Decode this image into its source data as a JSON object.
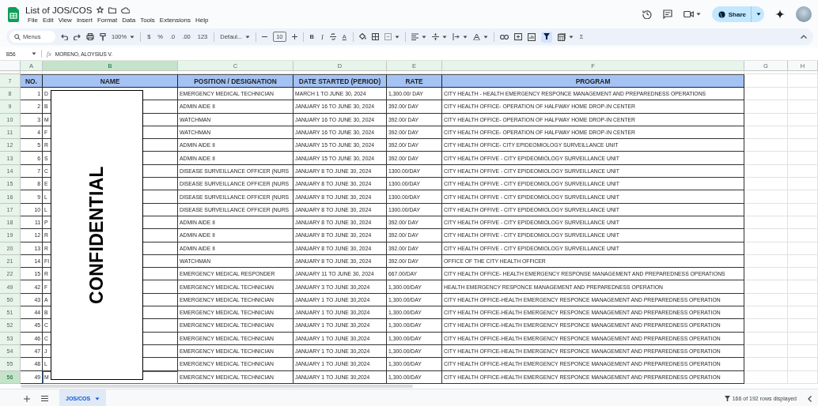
{
  "document": {
    "title": "List of JOS/COS"
  },
  "menu": [
    "File",
    "Edit",
    "View",
    "Insert",
    "Format",
    "Data",
    "Tools",
    "Extensions",
    "Help"
  ],
  "share_button": {
    "label": "Share"
  },
  "toolbar": {
    "search": {
      "placeholder": "Menus"
    },
    "zoom": "100%",
    "format_buttons": [
      "$",
      "%",
      ".0",
      ".00",
      "123"
    ],
    "font": "Defaul...",
    "font_size": "10",
    "text_buttons": [
      "B",
      "I"
    ],
    "text_color": "A",
    "function": "Σ",
    "filter_active": true
  },
  "formula_bar": {
    "cell": "B56",
    "fx": "fx",
    "formula": "MORENO, ALOYSIUS V."
  },
  "columns": [
    {
      "label": "A",
      "filtered": true,
      "selected": false
    },
    {
      "label": "B",
      "filtered": true,
      "selected": true
    },
    {
      "label": "C",
      "filtered": true,
      "selected": false
    },
    {
      "label": "D",
      "filtered": true,
      "selected": false
    },
    {
      "label": "E",
      "filtered": true,
      "selected": false
    },
    {
      "label": "F",
      "filtered": true,
      "selected": false
    },
    {
      "label": "G",
      "filtered": false,
      "selected": false
    },
    {
      "label": "H",
      "filtered": false,
      "selected": false
    }
  ],
  "table": {
    "header_row": "7",
    "headers": [
      "NO.",
      "NAME",
      "POSITION / DESIGNATION",
      "DATE STARTED (PERIOD)",
      "RATE",
      "PROGRAM"
    ],
    "rows": [
      {
        "row": "8",
        "no": "1",
        "name": "D",
        "position": "EMERGENCY MEDICAL TECHNICIAN",
        "date": " MARCH  1 TO JUNE 30, 2024",
        "rate": "1,300.00/ DAY",
        "program": "CITY HEALTH -  HEALTH EMERGENCY RESPONCE MANAGEMENT AND PREPAREDNESS OPERATIONS",
        "selected": false
      },
      {
        "row": "9",
        "no": "2",
        "name": "B",
        "position": "ADMIN AIDE II",
        "date": "JANUARY 16 TO JUNE 30, 2024",
        "rate": "392.00/ DAY",
        "program": "CITY HEALTH OFFICE- OPERATION OF HALFWAY HOME DROP-IN CENTER",
        "selected": false
      },
      {
        "row": "10",
        "no": "3",
        "name": "M",
        "position": "WATCHMAN",
        "date": "JANUARY 16 TO JUNE 30, 2024",
        "rate": "392.00/ DAY",
        "program": "CITY HEALTH OFFICE- OPERATION OF HALFWAY HOME DROP-IN CENTER",
        "selected": false
      },
      {
        "row": "11",
        "no": "4",
        "name": "F",
        "position": "WATCHMAN",
        "date": "JANUARY 16 TO JUNE 30, 2024",
        "rate": "392.00/ DAY",
        "program": "CITY HEALTH OFFICE- OPERATION OF HALFWAY HOME DROP-IN CENTER",
        "selected": false
      },
      {
        "row": "12",
        "no": "5",
        "name": "R",
        "position": "ADMIN AIDE II",
        "date": "JANUARY 15 TO JUNE 30, 2024",
        "rate": "392.00/ DAY",
        "program": "CITY HEALTH OFFICE- CITY EPIDEOMIOLOGY SURVEILLANCE UNIT",
        "selected": false
      },
      {
        "row": "13",
        "no": "6",
        "name": "S",
        "position": "ADMIN AIDE II",
        "date": "JANUARY 15 TO JUNE 30, 2024",
        "rate": "392.00/ DAY",
        "program": "CITY HEALTH OFFIVE - CITY EPIDEOMIOLOGY SURVEILLANCE UNIT",
        "selected": false
      },
      {
        "row": "14",
        "no": "7",
        "name": "C",
        "position": "DISEASE SURVEILLANCE OFFICER (NURS",
        "date": "JANUARY 8 TO JUNE 30, 2024",
        "rate": "1300.00/DAY",
        "program": "CITY HEALTH OFFIVE - CITY EPIDEOMIOLOGY SURVEILLANCE UNIT",
        "selected": false
      },
      {
        "row": "15",
        "no": "8",
        "name": "E",
        "position": "DISEASE SURVEILLANCE OFFICER (NURS",
        "date": "JANUARY 8 TO JUNE 30, 2024",
        "rate": "1300.00/DAY",
        "program": "CITY HEALTH OFFIVE - CITY EPIDEOMIOLOGY SURVEILLANCE UNIT",
        "selected": false
      },
      {
        "row": "16",
        "no": "9",
        "name": "L",
        "position": "DISEASE SURVEILLANCE OFFICER (NURS",
        "date": "JANUARY 8 TO JUNE 30, 2024",
        "rate": "1300.00/DAY",
        "program": "CITY HEALTH OFFIVE - CITY EPIDEOMIOLOGY SURVEILLANCE UNIT",
        "selected": false
      },
      {
        "row": "17",
        "no": "10",
        "name": "L",
        "position": "DISEASE SURVEILLANCE OFFICER (NURS",
        "date": "JANUARY 8 TO JUNE 30, 2024",
        "rate": "1300.00/DAY",
        "program": "CITY HEALTH OFFIVE - CITY EPIDEOMIOLOGY SURVEILLANCE UNIT",
        "selected": false
      },
      {
        "row": "18",
        "no": "11",
        "name": "P",
        "position": "ADMIN AIDE II",
        "date": "JANUARY 8 TO JUNE 30, 2024",
        "rate": "392.00/ DAY",
        "program": "CITY HEALTH OFFIVE - CITY EPIDEOMIOLOGY SURVEILLANCE UNIT",
        "selected": false
      },
      {
        "row": "19",
        "no": "12",
        "name": "R",
        "position": "ADMIN AIDE II",
        "date": "JANUARY 8 TO JUNE 30, 2024",
        "rate": "392.00/ DAY",
        "program": "CITY HEALTH OFFIVE - CITY EPIDEOMIOLOGY SURVEILLANCE UNIT",
        "selected": false
      },
      {
        "row": "20",
        "no": "13",
        "name": "R",
        "position": "ADMIN AIDE II",
        "date": "JANUARY 8 TO JUNE 30, 2024",
        "rate": "392.00/ DAY",
        "program": "CITY HEALTH OFFIVE - CITY EPIDEOMIOLOGY SURVEILLANCE UNIT",
        "selected": false
      },
      {
        "row": "21",
        "no": "14",
        "name": "FI",
        "position": "WATCHMAN",
        "date": "JANUARY 8 TO JUNE 30, 2024",
        "rate": "392.00/ DAY",
        "program": "OFFICE OF THE CITY HEALTH OFFICER",
        "selected": false
      },
      {
        "row": "22",
        "no": "15",
        "name": "R",
        "position": "EMERGENCY MEDICAL RESPONDER",
        "date": "JANUARY 11 TO JUNE 30, 2024",
        "rate": "667.00/DAY",
        "program": "CITY HEALTH OFFICE- HEALTH EMERGENCY RESPONSE MANAGEMENT AND PREPAREDNESS OPERATIONS",
        "selected": false
      },
      {
        "row": "49",
        "no": "42",
        "name": "F",
        "position": "EMERGENCY MEDICAL TECHNICIAN",
        "date": "JANUARY 3 TO JUNE 30,2024",
        "rate": "1,300.00/DAY",
        "program": "HEALTH EMERGENCY RESPONCE MANAGEMENT AND PREPAREDNESS OPERATION",
        "selected": false
      },
      {
        "row": "50",
        "no": "43",
        "name": "A",
        "position": "EMERGENCY MEDICAL TECHNICIAN",
        "date": "JANUARY 1 TO JUNE 30,2024",
        "rate": "1,300.00/DAY",
        "program": "CITY HEALTH OFFICE-HEALTH EMERGENCY RESPONCE MANAGEMENT AND PREPAREDNESS OPERATION",
        "selected": false
      },
      {
        "row": "51",
        "no": "44",
        "name": "B",
        "position": "EMERGENCY MEDICAL TECHNICIAN",
        "date": "JANUARY 1 TO JUNE 30,2024",
        "rate": "1,300.00/DAY",
        "program": "CITY HEALTH OFFICE-HEALTH EMERGENCY RESPONCE MANAGEMENT AND PREPAREDNESS OPERATION",
        "selected": false
      },
      {
        "row": "52",
        "no": "45",
        "name": "C",
        "position": "EMERGENCY MEDICAL TECHNICIAN",
        "date": "JANUARY 1 TO JUNE 30,2024",
        "rate": "1,300.00/DAY",
        "program": "CITY HEALTH OFFICE-HEALTH EMERGENCY RESPONCE MANAGEMENT AND PREPAREDNESS OPERATION",
        "selected": false
      },
      {
        "row": "53",
        "no": "46",
        "name": "C",
        "position": "EMERGENCY MEDICAL TECHNICIAN",
        "date": "JANUARY 1 TO JUNE 30,2024",
        "rate": "1,300.00/DAY",
        "program": "CITY HEALTH OFFICE-HEALTH EMERGENCY RESPONCE MANAGEMENT AND PREPAREDNESS OPERATION",
        "selected": false
      },
      {
        "row": "54",
        "no": "47",
        "name": "J",
        "position": "EMERGENCY MEDICAL TECHNICIAN",
        "date": "JANUARY 1 TO JUNE 30,2024",
        "rate": "1,300.00/DAY",
        "program": "CITY HEALTH OFFICE-HEALTH EMERGENCY RESPONCE MANAGEMENT AND PREPAREDNESS OPERATION",
        "selected": false
      },
      {
        "row": "55",
        "no": "48",
        "name": "L",
        "position": "EMERGENCY MEDICAL TECHNICIAN",
        "date": "JANUARY 1 TO JUNE 30,2024",
        "rate": "1,300.00/DAY",
        "program": "CITY HEALTH OFFICE-HEALTH EMERGENCY RESPONCE MANAGEMENT AND PREPAREDNESS OPERATION",
        "selected": false
      },
      {
        "row": "56",
        "no": "49",
        "name": "M",
        "position": "EMERGENCY MEDICAL TECHNICIAN",
        "date": "JANUARY 1 TO JUNE 30,2024",
        "rate": "1,300.00/DAY",
        "program": "CITY HEALTH OFFICE-HEALTH EMERGENCY RESPONCE MANAGEMENT AND PREPAREDNESS OPERATION",
        "selected": true
      }
    ]
  },
  "redaction": {
    "label": "CONFIDENTIAL"
  },
  "sheet_tabs": [
    {
      "label": "JOS/COS",
      "selected": true
    }
  ],
  "status": "166 of 192 rows displayed"
}
